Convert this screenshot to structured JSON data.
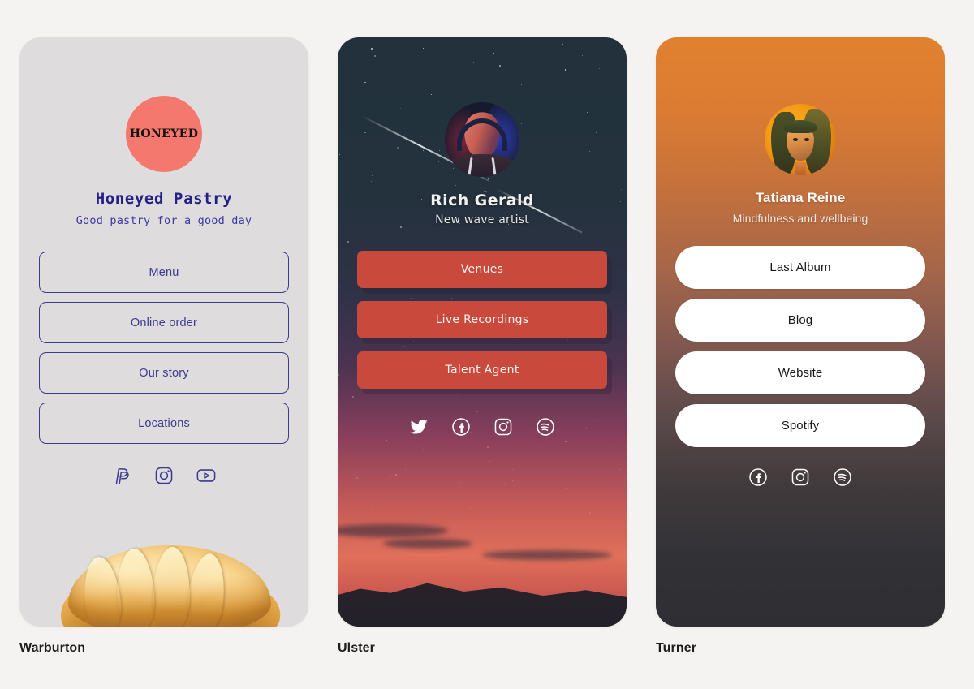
{
  "page": {
    "background_color": "#f4f3f1"
  },
  "cards": [
    {
      "caption": "Warburton",
      "theme": "light-gray",
      "background_color": "#dedcdc",
      "accent_color": "#f4786e",
      "text_color": "#232089",
      "logo_text": "HONEYED",
      "title": "Honeyed Pastry",
      "subtitle": "Good pastry for a good day",
      "buttons": [
        {
          "label": "Menu"
        },
        {
          "label": "Online order"
        },
        {
          "label": "Our story"
        },
        {
          "label": "Locations"
        }
      ],
      "social": [
        {
          "name": "paypal-icon"
        },
        {
          "name": "instagram-icon"
        },
        {
          "name": "youtube-icon"
        }
      ],
      "photo": "croissant-photo"
    },
    {
      "caption": "Ulster",
      "theme": "night-sky",
      "background_color": "#22313c",
      "accent_color": "#c9493c",
      "text_color": "#f2f1ee",
      "title": "Rich Gerald",
      "subtitle": "New wave artist",
      "buttons": [
        {
          "label": "Venues"
        },
        {
          "label": "Live Recordings"
        },
        {
          "label": "Talent Agent"
        }
      ],
      "social": [
        {
          "name": "twitter-icon"
        },
        {
          "name": "facebook-icon"
        },
        {
          "name": "instagram-icon"
        },
        {
          "name": "spotify-icon"
        }
      ],
      "photo": "artist-headshot-photo"
    },
    {
      "caption": "Turner",
      "theme": "sunset-gradient",
      "background_color": "#e0812f",
      "accent_color": "#ffffff",
      "text_color": "#fbfaf8",
      "title": "Tatiana Reine",
      "subtitle": "Mindfulness and wellbeing",
      "buttons": [
        {
          "label": "Last Album"
        },
        {
          "label": "Blog"
        },
        {
          "label": "Website"
        },
        {
          "label": "Spotify"
        }
      ],
      "social": [
        {
          "name": "facebook-icon"
        },
        {
          "name": "instagram-icon"
        },
        {
          "name": "spotify-icon"
        }
      ],
      "photo": "portrait-duotone-photo"
    }
  ]
}
